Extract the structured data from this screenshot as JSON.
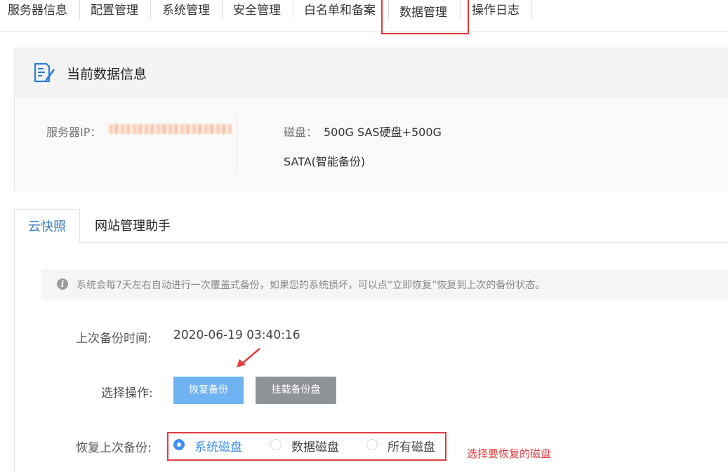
{
  "topnav": {
    "tabs": [
      {
        "label": "服务器信息"
      },
      {
        "label": "配置管理"
      },
      {
        "label": "系统管理"
      },
      {
        "label": "安全管理"
      },
      {
        "label": "白名单和备案"
      },
      {
        "label": "数据管理"
      },
      {
        "label": "操作日志"
      }
    ],
    "active_tab": "数据管理"
  },
  "info_panel": {
    "title": "当前数据信息",
    "server_ip_label": "服务器IP：",
    "disk_label": "磁盘：",
    "disk_value_line1": "500G SAS硬盘+500G",
    "disk_value_line2": "SATA(智能备份)"
  },
  "sub_tabs": [
    {
      "label": "云快照",
      "active": true
    },
    {
      "label": "网站管理助手",
      "active": false
    }
  ],
  "notice": {
    "text": "系统会每7天左右自动进行一次覆盖式备份，如果您的系统损坏，可以点“立即恢复”恢复到上次的备份状态。"
  },
  "backup": {
    "last_backup_label": "上次备份时间:",
    "last_backup_value": "2020-06-19 03:40:16",
    "action_label": "选择操作:",
    "restore_button": "恢复备份",
    "mount_button": "挂载备份盘",
    "restore_last_label": "恢复上次备份:",
    "options": [
      {
        "label": "系统磁盘",
        "checked": true
      },
      {
        "label": "数据磁盘",
        "checked": false
      },
      {
        "label": "所有磁盘",
        "checked": false
      }
    ],
    "annotation": "选择要恢复的磁盘"
  },
  "colors": {
    "accent": "#3d8ff0",
    "primary_button": "#6fb3f3",
    "gray_button": "#8f9296",
    "annotation_red": "#e23b3b"
  }
}
